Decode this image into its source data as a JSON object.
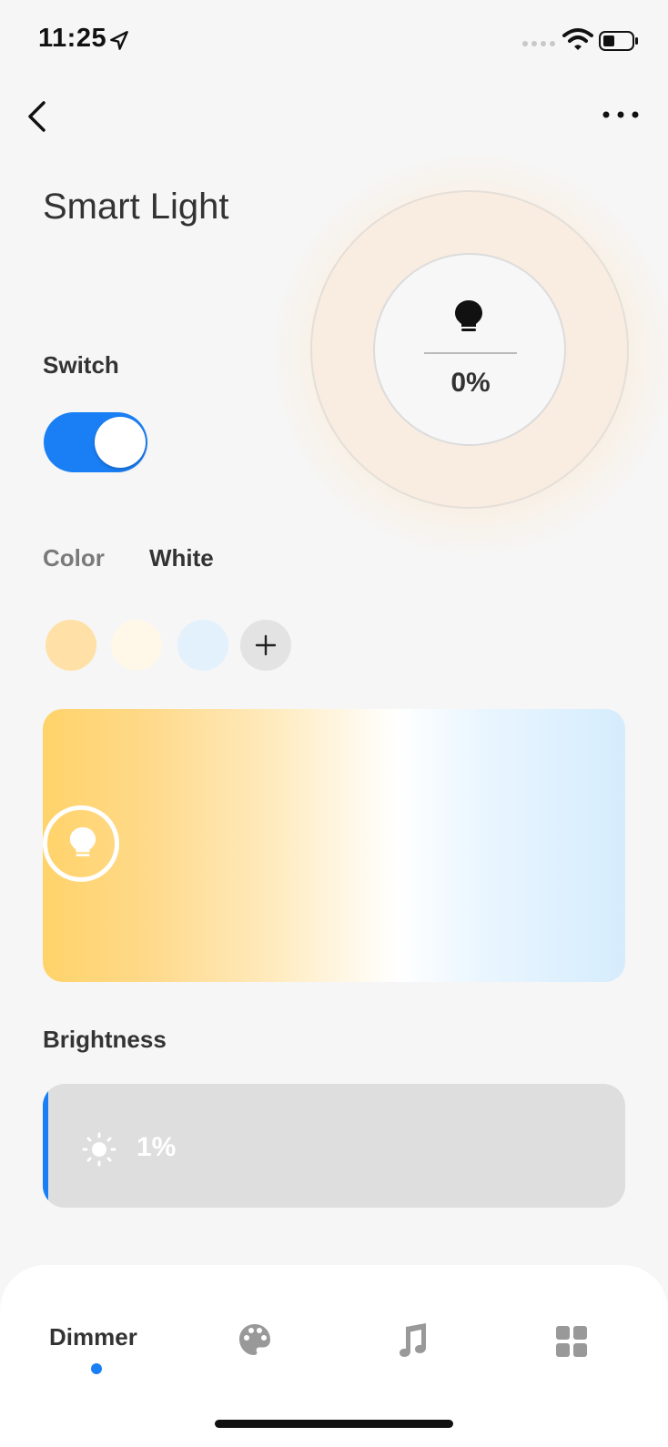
{
  "status_bar": {
    "time": "11:25",
    "icons": [
      "location-arrow-icon",
      "signal-icon",
      "wifi-icon",
      "battery-icon"
    ]
  },
  "nav": {
    "back_icon": "chevron-left-icon",
    "more_icon": "more-horizontal-icon"
  },
  "device": {
    "title": "Smart Light"
  },
  "dial": {
    "icon": "lightbulb-icon",
    "value": "0%"
  },
  "switch": {
    "label": "Switch",
    "on": true
  },
  "mode_tabs": {
    "color": "Color",
    "white": "White",
    "selected": "White"
  },
  "swatches": {
    "colors": [
      "#ffe0a6",
      "#fff7e8",
      "#e3f1fd"
    ],
    "add_icon": "plus-icon"
  },
  "temperature": {
    "handle_icon": "lightbulb-icon",
    "position": 0.03
  },
  "brightness": {
    "label": "Brightness",
    "value": "1%",
    "fraction": 0.01,
    "icon": "sun-icon"
  },
  "bottom_nav": {
    "dimmer": "Dimmer",
    "items": [
      "palette-icon",
      "music-note-icon",
      "grid-icon"
    ],
    "active": "Dimmer"
  },
  "colors": {
    "accent": "#1a7ff5",
    "background": "#f6f6f6",
    "track": "#dedede"
  }
}
